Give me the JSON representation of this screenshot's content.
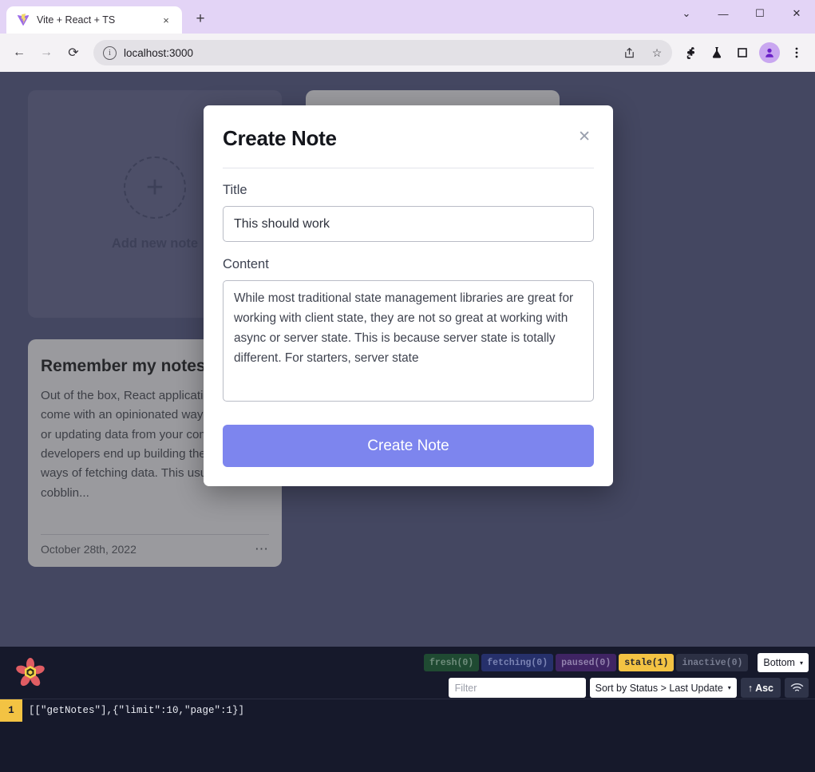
{
  "browser": {
    "tab": {
      "title": "Vite + React + TS",
      "favicon": "vite-logo-icon",
      "close_label": "×"
    },
    "new_tab_label": "+",
    "window_controls": [
      {
        "name": "tab-search-button",
        "glyph": "⌄"
      },
      {
        "name": "minimize-button",
        "glyph": "—"
      },
      {
        "name": "maximize-button",
        "glyph": "☐"
      },
      {
        "name": "close-window-button",
        "glyph": "✕"
      }
    ],
    "nav": {
      "back_glyph": "←",
      "forward_glyph": "→",
      "reload_glyph": "⟳"
    },
    "omnibox": {
      "url": "localhost:3000",
      "info_glyph": "i",
      "share_glyph": "➦",
      "bookmark_glyph": "☆"
    },
    "toolbar_icons": [
      {
        "name": "extensions-puzzle-icon"
      },
      {
        "name": "lab-flask-icon"
      },
      {
        "name": "split-screen-icon"
      },
      {
        "name": "profile-avatar-icon"
      },
      {
        "name": "browser-menu-icon"
      }
    ]
  },
  "page": {
    "add_card": {
      "plus_glyph": "+",
      "label": "Add new note"
    },
    "notes": [
      {
        "title": "Remember my notes",
        "body": "Out of the box, React applications do not come with an opinionated way of fetching or updating data from your components so developers end up building their own ways of fetching data. This usually means cobblin...",
        "date": "October 28th, 2022",
        "menu_glyph": "⋯"
      }
    ]
  },
  "modal": {
    "title": "Create Note",
    "close_glyph": "✕",
    "title_field": {
      "label": "Title",
      "value": "This should work",
      "placeholder": "Title"
    },
    "content_field": {
      "label": "Content",
      "value": "While most traditional state management libraries are great for working with client state, they are not so great at working with async or server state. This is because server state is totally different. For starters, server state",
      "placeholder": "Content"
    },
    "submit_label": "Create Note",
    "accent_color": "#7d85ee"
  },
  "devtools": {
    "logo_name": "react-query-logo",
    "status_badges": [
      {
        "label": "fresh(0)",
        "color": "#1f4a32"
      },
      {
        "label": "fetching(0)",
        "color": "#26306b"
      },
      {
        "label": "paused(0)",
        "color": "#3f2463"
      },
      {
        "label": "stale(1)",
        "color": "#f3c343"
      },
      {
        "label": "inactive(0)",
        "color": "#2c3044"
      }
    ],
    "position_select": {
      "value": "Bottom",
      "caret": "▾"
    },
    "filter": {
      "placeholder": "Filter",
      "value": ""
    },
    "sort_select": {
      "value": "Sort by Status > Last Update",
      "caret": "▾"
    },
    "sort_direction": {
      "label": "Asc",
      "arrow": "↑"
    },
    "wifi_icon": "offline-mode-icon",
    "queries": [
      {
        "observers": "1",
        "key": "[[\"getNotes\"],{\"limit\":10,\"page\":1}]"
      }
    ]
  }
}
